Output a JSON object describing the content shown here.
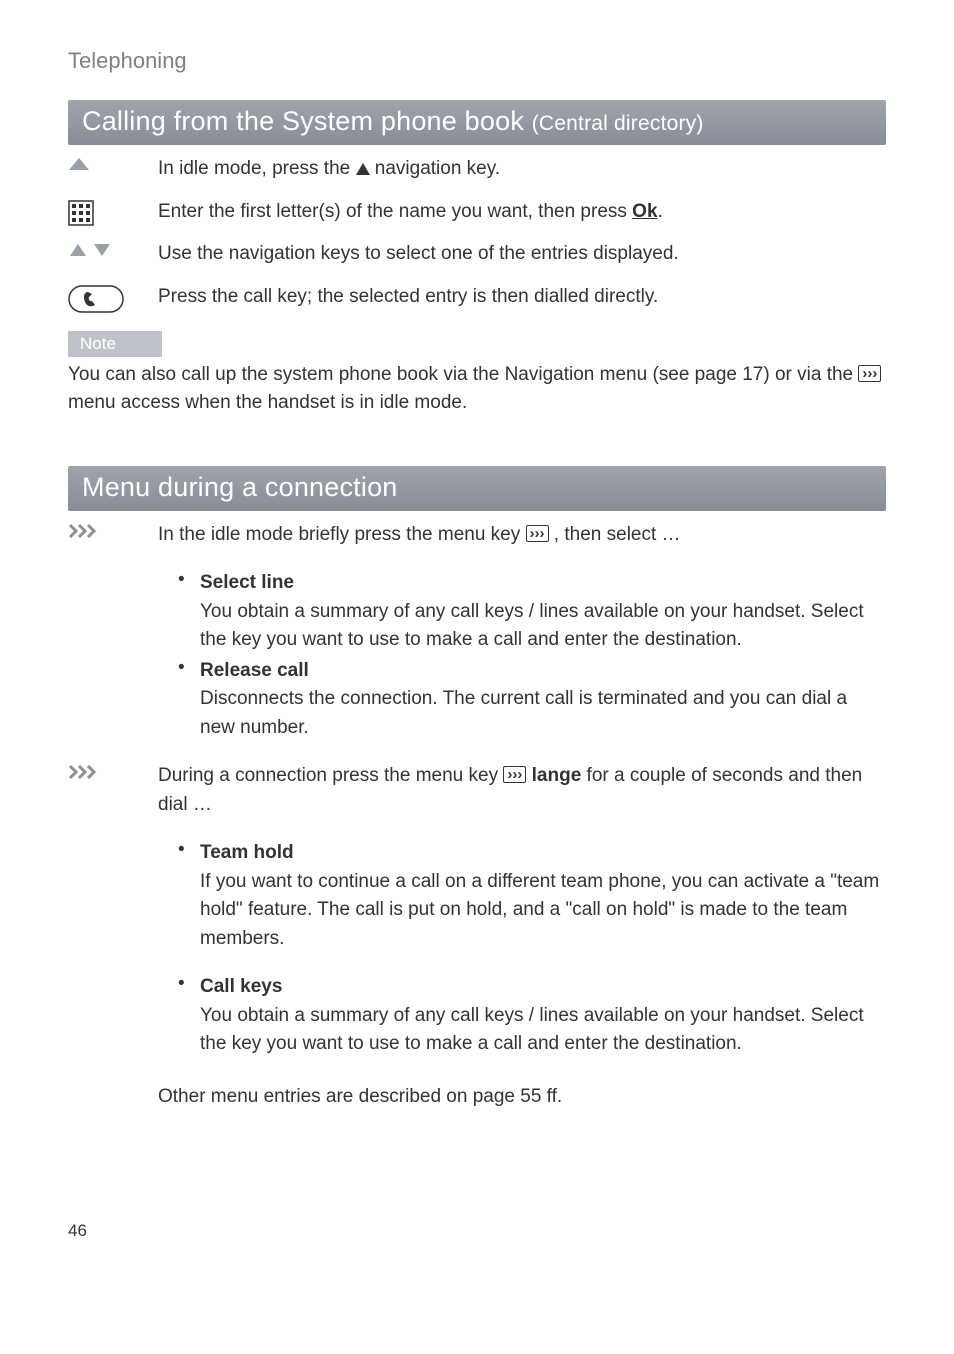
{
  "header": "Telephoning",
  "section1": {
    "title": "Calling from the System phone book ",
    "sub": "(Central directory)"
  },
  "r1": "In idle mode, press the ",
  "r1b": " navigation key.",
  "r2a": "Enter the first letter(s) of the name you want, then press ",
  "r2b": "Ok",
  "r2c": ".",
  "r3": "Use the navigation keys to select one of the entries displayed.",
  "r4": "Press the call key; the selected entry is then dialled directly.",
  "noteLabel": "Note",
  "noteA": "You can also call up the system phone book via the Navigation menu (see  page 17) or via the ",
  "noteB": " menu access when the handset is in idle mode.",
  "section2": "Menu during a connection",
  "m1a": "In the idle mode briefly press the menu key  ",
  "m1b": " , then select …",
  "b1t": "Select line",
  "b1d": "You obtain a summary of any call keys / lines available on your handset. Select the key you want to use to make a call and enter the destination.",
  "b2t": "Release call",
  "b2d": "Disconnects the connection. The current call is terminated and you can dial a new number.",
  "m2a": "During a connection press the menu key  ",
  "m2b": " lange",
  "m2c": " for a couple of seconds and then dial …",
  "b3t": "Team hold",
  "b3d": "If you want to continue a call on a different team phone, you can activate a \"team hold\" feature. The call is put on hold, and a \"call on hold\" is made to the team members.",
  "b4t": "Call keys",
  "b4d": "You obtain a summary of any call keys / lines available on your handset. Select the key you want to use to make a call and enter the destination.",
  "other": "Other menu entries are described on page 55 ff.",
  "pageNum": "46"
}
